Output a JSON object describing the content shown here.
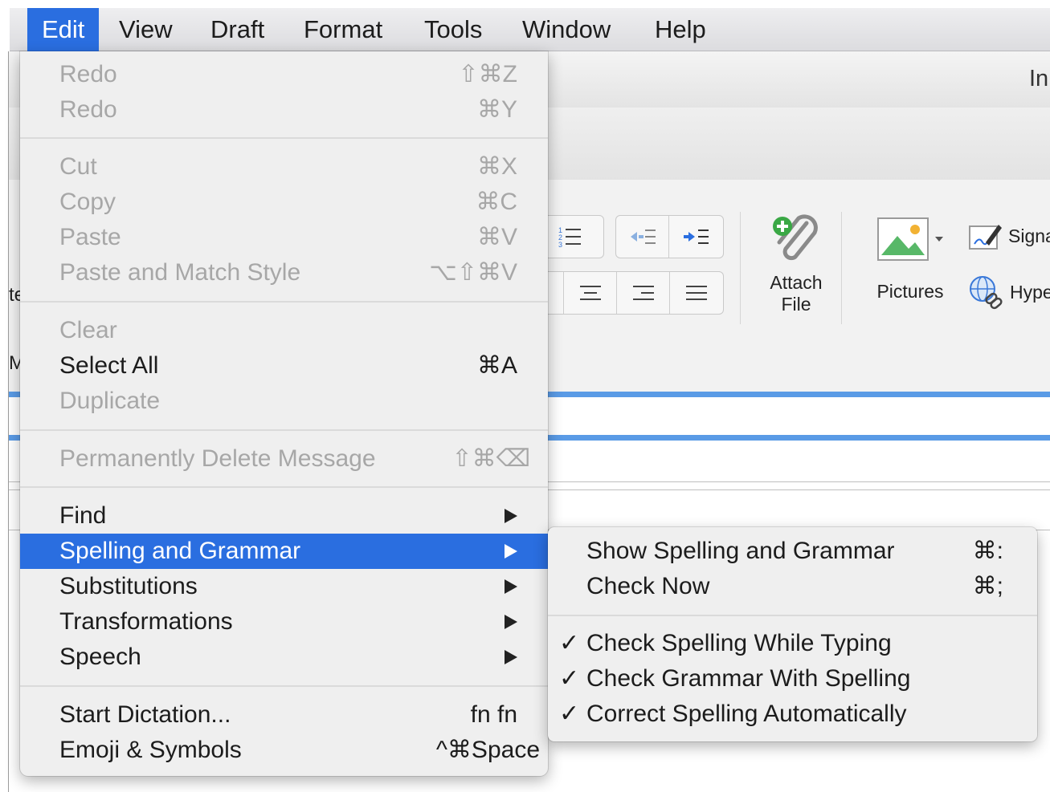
{
  "menubar": {
    "items": [
      "Edit",
      "View",
      "Draft",
      "Format",
      "Tools",
      "Window",
      "Help"
    ],
    "active": "Edit"
  },
  "window": {
    "title": "In",
    "ribbon": {
      "attach_label_line1": "Attach",
      "attach_label_line2": "File",
      "pictures_label": "Pictures",
      "signature_label": "Signa",
      "hyperlink_label": "Hype",
      "left_clip_1": "te",
      "left_clip_2": "Mi"
    }
  },
  "edit_menu": {
    "redo1": {
      "label": "Redo",
      "shortcut": "⇧⌘Z"
    },
    "redo2": {
      "label": "Redo",
      "shortcut": "⌘Y"
    },
    "cut": {
      "label": "Cut",
      "shortcut": "⌘X"
    },
    "copy": {
      "label": "Copy",
      "shortcut": "⌘C"
    },
    "paste": {
      "label": "Paste",
      "shortcut": "⌘V"
    },
    "paste_match": {
      "label": "Paste and Match Style",
      "shortcut": "⌥⇧⌘V"
    },
    "clear": {
      "label": "Clear"
    },
    "select_all": {
      "label": "Select All",
      "shortcut": "⌘A"
    },
    "duplicate": {
      "label": "Duplicate"
    },
    "perm_delete": {
      "label": "Permanently Delete Message",
      "shortcut": "⇧⌘⌫"
    },
    "find": {
      "label": "Find"
    },
    "spelling": {
      "label": "Spelling and Grammar"
    },
    "substitutions": {
      "label": "Substitutions"
    },
    "transformations": {
      "label": "Transformations"
    },
    "speech": {
      "label": "Speech"
    },
    "dictation": {
      "label": "Start Dictation...",
      "shortcut": "fn fn"
    },
    "emoji": {
      "label": "Emoji & Symbols",
      "shortcut": "^⌘Space"
    }
  },
  "spelling_submenu": {
    "show": {
      "label": "Show Spelling and Grammar",
      "shortcut": "⌘:"
    },
    "check_now": {
      "label": "Check Now",
      "shortcut": "⌘;"
    },
    "check_while_typing": {
      "label": "Check Spelling While Typing",
      "check": "✓"
    },
    "check_grammar": {
      "label": "Check Grammar With Spelling",
      "check": "✓"
    },
    "correct_auto": {
      "label": "Correct Spelling Automatically",
      "check": "✓"
    }
  },
  "colors": {
    "highlight": "#2a6ee0",
    "disabled_text": "#a7a7a7",
    "accent_line": "#5a9be6"
  }
}
